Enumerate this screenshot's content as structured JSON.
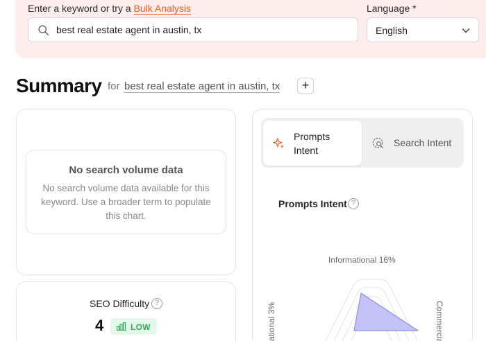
{
  "search": {
    "prompt_prefix": "Enter a keyword or try a",
    "bulk_link": "Bulk Analysis",
    "keyword_value": "best real estate agent in austin, tx",
    "language_label": "Language *",
    "language_value": "English"
  },
  "summary": {
    "title": "Summary",
    "for_label": "for",
    "keyword": "best real estate agent in austin, tx",
    "add_symbol": "+"
  },
  "volume_card": {
    "empty_title": "No search volume data",
    "empty_text": "No search volume data available for this keyword. Use a broader term to populate this chart."
  },
  "seo_card": {
    "title": "SEO Difficulty",
    "value": "4",
    "badge": "LOW",
    "help": "?"
  },
  "intent_card": {
    "tabs": [
      {
        "label": "Prompts Intent",
        "icon": "sparkle-icon",
        "active": true
      },
      {
        "label": "Search Intent",
        "icon": "search-intent-icon",
        "active": false
      }
    ],
    "section_title": "Prompts Intent",
    "help": "?",
    "radar_labels": {
      "top": "Informational 16%",
      "left": "ational 3%",
      "right": "Commercia"
    }
  },
  "colors": {
    "accent": "#e8611f",
    "banner_bg": "#fdeeed",
    "low_badge_bg": "#e4f7ea",
    "low_badge_text": "#2bae5a",
    "radar_fill": "#b8b9f7"
  }
}
